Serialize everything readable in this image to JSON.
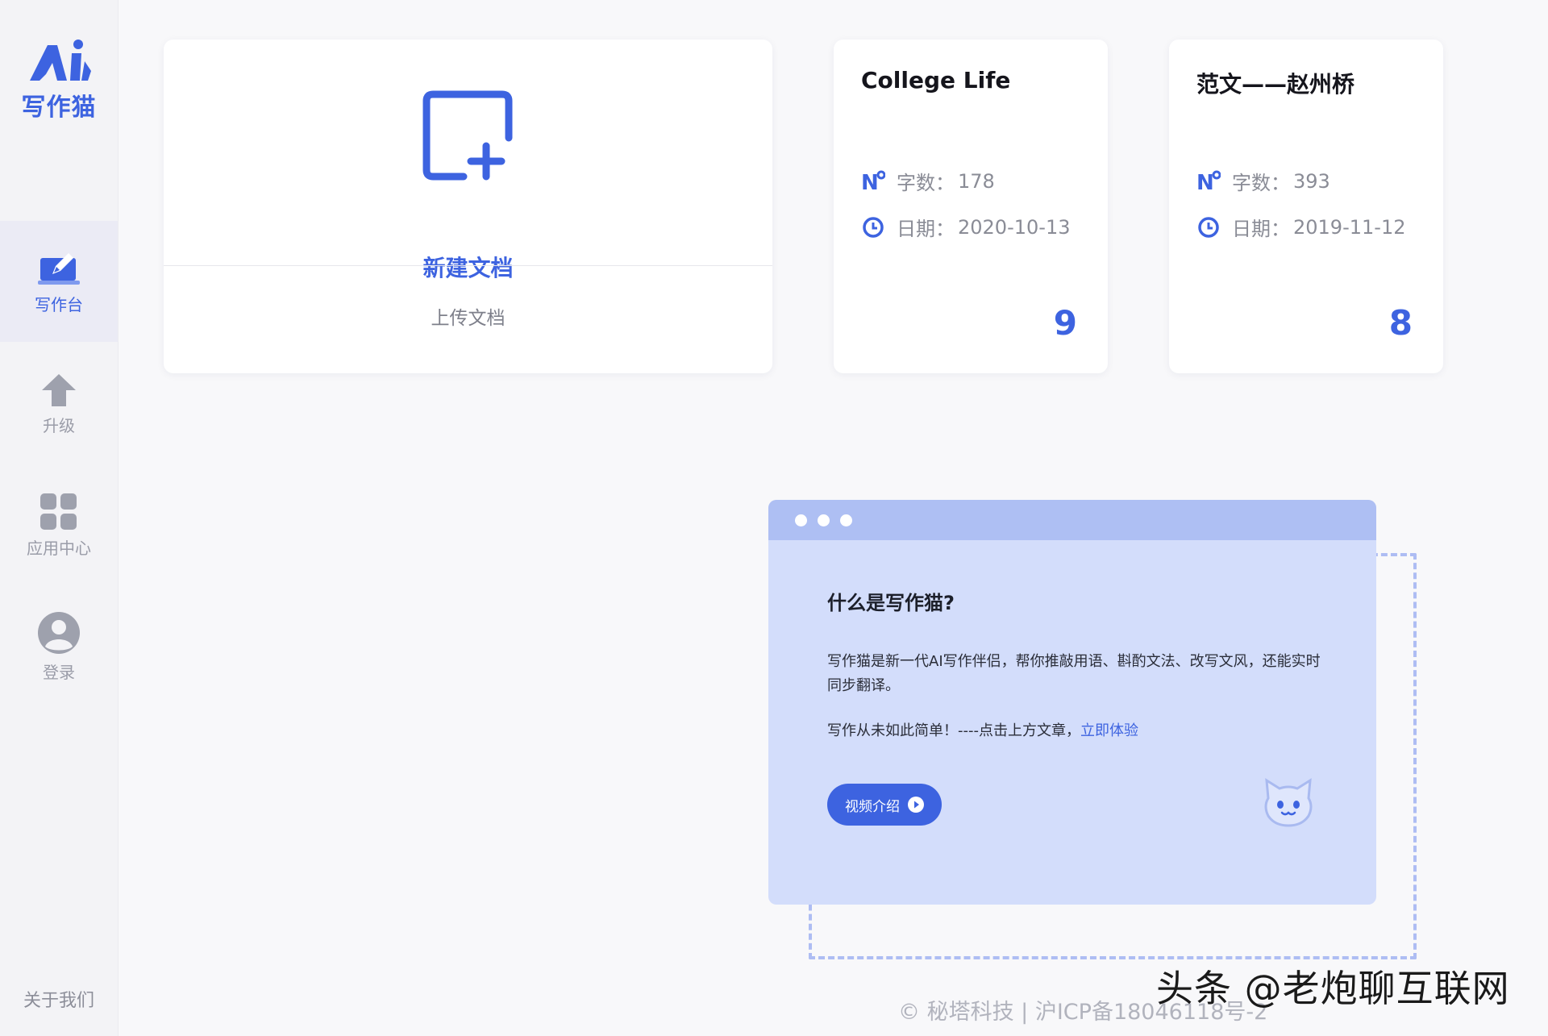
{
  "app": {
    "logo_text": "写作猫"
  },
  "sidebar": {
    "items": [
      {
        "label": "写作台",
        "icon": "write-desk-icon",
        "active": true
      },
      {
        "label": "升级",
        "icon": "upgrade-arrow-icon"
      },
      {
        "label": "应用中心",
        "icon": "app-grid-icon"
      },
      {
        "label": "登录",
        "icon": "user-avatar-icon"
      }
    ],
    "about_label": "关于我们"
  },
  "new_doc": {
    "create_label": "新建文档",
    "upload_label": "上传文档"
  },
  "documents": [
    {
      "title": "College Life",
      "count_label": "字数：",
      "count": "178",
      "date_label": "日期：",
      "date": "2020-10-13",
      "score": "9"
    },
    {
      "title": "范文——赵州桥",
      "count_label": "字数：",
      "count": "393",
      "date_label": "日期：",
      "date": "2019-11-12",
      "score": "8"
    }
  ],
  "intro": {
    "title": "什么是写作猫?",
    "paragraph1": "写作猫是新一代AI写作伴侣，帮你推敲用语、斟酌文法、改写文风，还能实时同步翻译。",
    "paragraph2_prefix": "写作从未如此简单！----点击上方文章，",
    "try_link": "立即体验",
    "video_button": "视频介绍"
  },
  "footer": {
    "text": "© 秘塔科技 | 沪ICP备18046118号-2"
  },
  "watermark": {
    "text": "头条 @老炮聊互联网"
  },
  "colors": {
    "accent": "#3d63e0",
    "panel": "#d3ddfb",
    "panel_bar": "#aebff3"
  }
}
